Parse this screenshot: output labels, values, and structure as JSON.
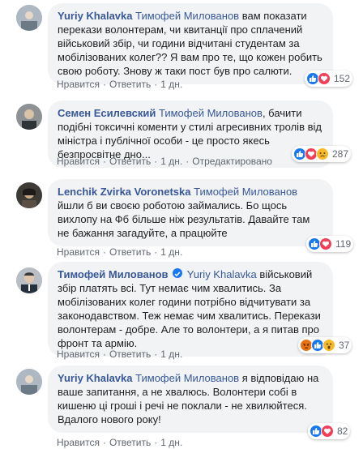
{
  "comments": [
    {
      "author": "Yuriy Khalavka",
      "mention": "Тимофей Милованов",
      "text": " вам показати перекази волонтерам, чи квитанції про сплачений військовий збір, чи години відчитані студентам за мобілізованих колег?? Я вам про те, що кожен робить свою роботу. Знову ж таки пост був про салюти.",
      "like_label": "Нравится",
      "reply_label": "Ответить",
      "time": "1 дн.",
      "edited": "",
      "reactions": [
        "like-icon",
        "love-icon"
      ],
      "reaction_count": "152"
    },
    {
      "author": "Семен Есилевский",
      "mention": "Тимофей Милованов",
      "text": ", бачити подібні токсичні коменти у стилі агресивних тролів від міністра і публічної особи - це просто якесь безпросвітне дно...",
      "like_label": "Нравится",
      "reply_label": "Ответить",
      "time": "1 дн.",
      "edited": "Отредактировано",
      "reactions": [
        "like-icon",
        "love-icon",
        "sad-icon"
      ],
      "reaction_count": "287"
    },
    {
      "author": "Lenchik Zvirka Voronetska",
      "mention": "Тимофей Милованов",
      "text": " йшли б ви своєю роботою займались. Бо щось вихлопу на Фб більше ніж результатів. Давайте там не бажання загадуйте, а працюйте",
      "like_label": "Нравится",
      "reply_label": "Ответить",
      "time": "1 дн.",
      "edited": "",
      "reactions": [
        "like-icon",
        "love-icon"
      ],
      "reaction_count": "119"
    },
    {
      "author": "Тимофей Милованов",
      "mention": "Yuriy Khalavka",
      "text": " військовий збір платять всі. Тут немає чим хвалитись. За мобілізованих колег години потрібно відчитувати за законодавством. Теж немає чим хвалитись. Перекази волонтерам - добре. Але то волонтери, а я питав про фронт та армію.",
      "like_label": "Нравится",
      "reply_label": "Ответить",
      "time": "1 дн.",
      "edited": "",
      "reactions": [
        "angry-icon",
        "like-icon",
        "wow-icon"
      ],
      "reaction_count": "37"
    },
    {
      "author": "Yuriy Khalavka",
      "mention": "Тимофей Милованов",
      "text": " я відповідаю на ваше запитання, а не хвалюсь. Волонтери собі в кишеню ці гроші і речі не поклали - не хвилюйтеся. Вдалого нового року!",
      "like_label": "Нравится",
      "reply_label": "Ответить",
      "time": "1 дн.",
      "edited": "",
      "reactions": [
        "like-icon",
        "love-icon"
      ],
      "reaction_count": "82"
    }
  ],
  "colors": {
    "link": "#385898",
    "bubble": "#f2f3f5",
    "meta": "#606770",
    "like": "#1877f2",
    "love": "#f33e58",
    "haha_sad_wow": "#f7b928",
    "angry": "#e9710f"
  }
}
